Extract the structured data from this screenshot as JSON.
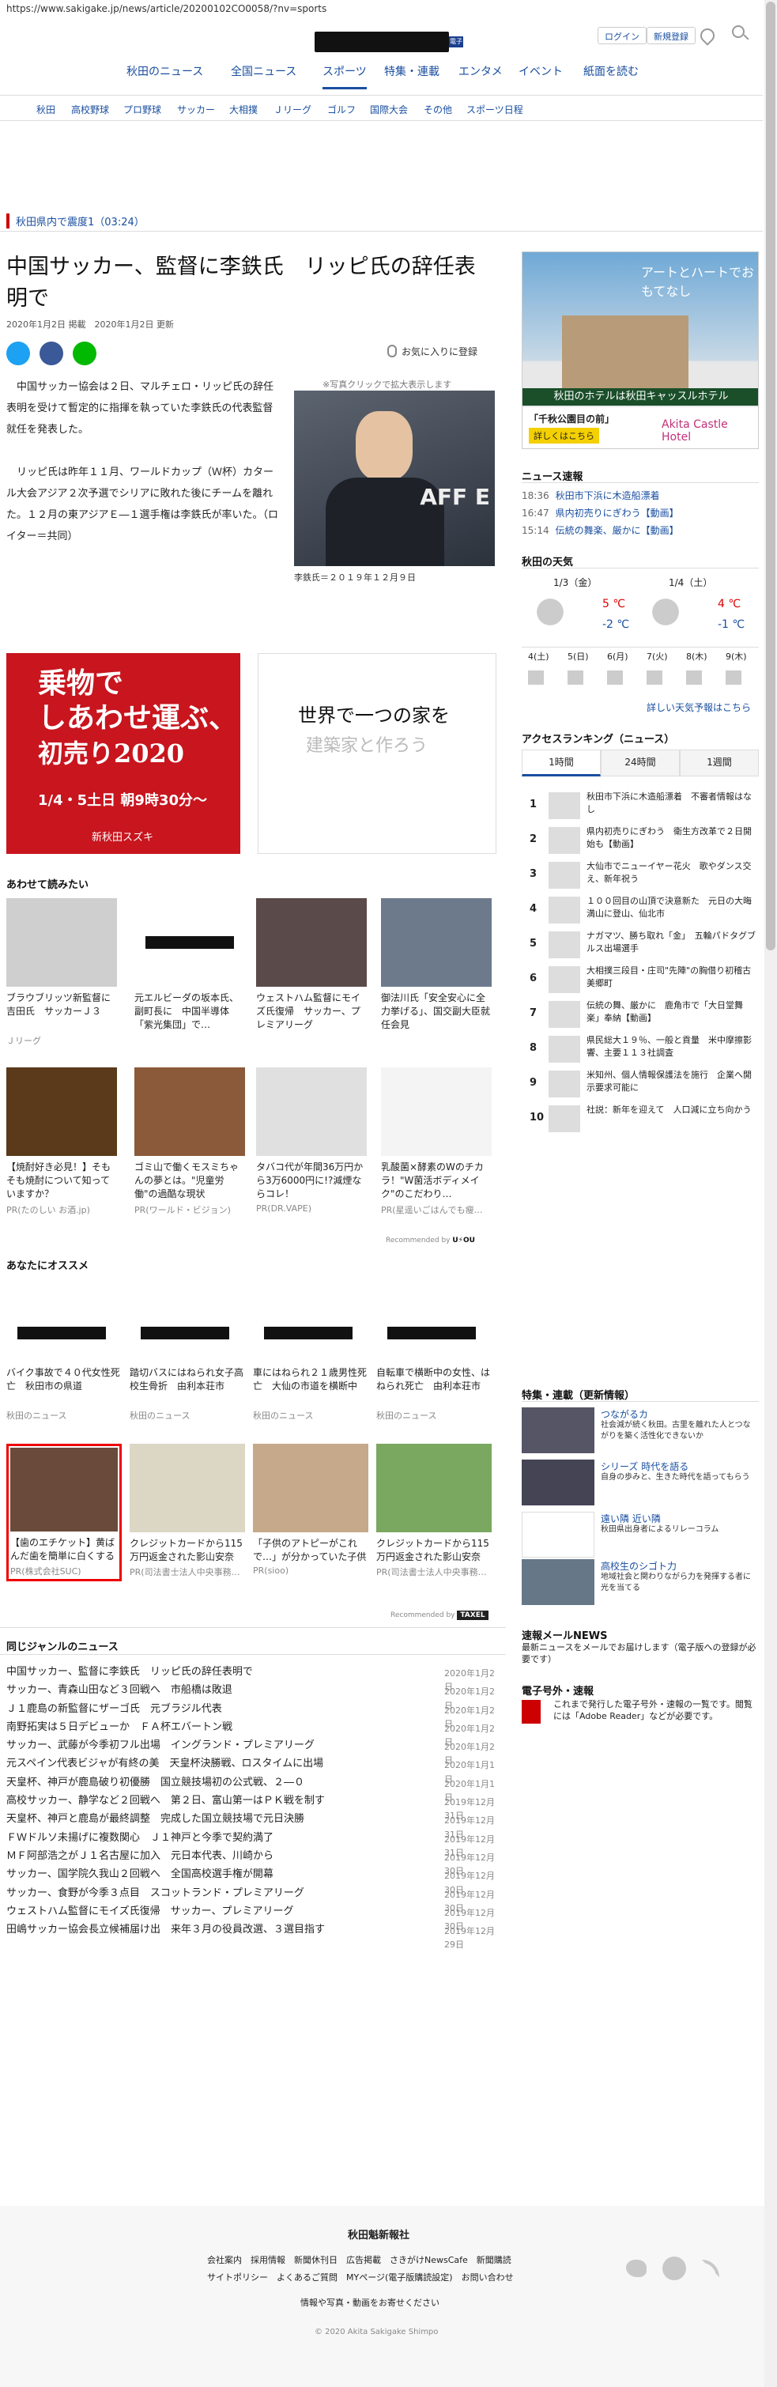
{
  "url": "https://www.sakigake.jp/news/article/20200102CO0058/?nv=sports",
  "header": {
    "login": "ログイン",
    "register": "新規登録"
  },
  "mainnav": [
    "秋田のニュース",
    "全国ニュース",
    "スポーツ",
    "特集・連載",
    "エンタメ",
    "イベント",
    "紙面を読む"
  ],
  "subnav": [
    "秋田",
    "高校野球",
    "プロ野球",
    "サッカー",
    "大相撲",
    "Ｊリーグ",
    "ゴルフ",
    "国際大会",
    "その他",
    "スポーツ日程"
  ],
  "breaking": "秋田県内で震度1（03:24）",
  "article": {
    "title": "中国サッカー、監督に李鉄氏　リッピ氏の辞任表明で",
    "date": "2020年1月2日 掲載　2020年1月2日 更新",
    "fav": "お気に入りに登録",
    "photo_note": "※写真クリックで拡大表示します",
    "photo_caption": "李鉄氏＝２０１９年１２月９日",
    "p1": "中国サッカー協会は２日、マルチェロ・リッピ氏の辞任表明を受けて暫定的に指揮を執っていた李鉄氏の代表監督就任を発表した。",
    "p2": "リッピ氏は昨年１１月、ワールドカップ（Ｗ杯）カタール大会アジア２次予選でシリアに敗れた後にチームを離れた。１２月の東アジアＥ―１選手権は李鉄氏が率いた。（ロイター＝共同）"
  },
  "ads": {
    "ad1_l1": "乗物で",
    "ad1_l2": "しあわせ運ぶ、",
    "ad1_l3": "初売り2020",
    "ad1_date": "1/4・5土日 朝9時30分～",
    "ad1_brand": "新秋田スズキ",
    "ad2_l1": "世界で一つの家を",
    "ad2_l2": "建築家と作ろう"
  },
  "related": {
    "heading": "あわせて読みたい",
    "items": [
      {
        "t": "ブラウブリッツ新監督に吉田氏　サッカーＪ３",
        "s": "Ｊリーグ"
      },
      {
        "t": "元エルビーダの坂本氏、副町長に　中国半導体「紫光集団」で…",
        "s": ""
      },
      {
        "t": "ウェストハム監督にモイズ氏復帰　サッカー、プレミアリーグ",
        "s": ""
      },
      {
        "t": "御法川氏「安全安心に全力挙げる」、国交副大臣就任会見",
        "s": ""
      },
      {
        "t": "【焼酎好き必見！】そもそも焼酎について知っていますか？",
        "s": "PR(たのしい お酒.jp)"
      },
      {
        "t": "ゴミ山で働くモスミちゃんの夢とは。\"児童労働\"の過酷な現状",
        "s": "PR(ワールド・ビジョン)"
      },
      {
        "t": "タバコ代が年間36万円から3万6000円に!?減煙ならコレ！",
        "s": "PR(DR.VAPE)"
      },
      {
        "t": "乳酸菌×酵素のWのチカラ！\"W菌活ボディメイク\"のこだわり…",
        "s": "PR(星遥いごはんでも瘦…"
      }
    ],
    "recommended": "Recommended by"
  },
  "recommend": {
    "heading": "あなたにオススメ",
    "items": [
      {
        "t": "バイク事故で４０代女性死亡　秋田市の県道",
        "s": "秋田のニュース"
      },
      {
        "t": "踏切バスにはねられ女子高校生骨折　由利本荘市",
        "s": "秋田のニュース"
      },
      {
        "t": "車にはねられ２１歳男性死亡　大仙の市道を横断中",
        "s": "秋田のニュース"
      },
      {
        "t": "自転車で横断中の女性、はねられ死亡　由利本荘市",
        "s": "秋田のニュース"
      },
      {
        "t": "【歯のエチケット】黄ばんだ歯を簡単に白くする方法が大…",
        "s": "PR(株式会社SUC)"
      },
      {
        "t": "クレジットカードから115万円返金された影山安奈（68）男性",
        "s": "PR(司法書士法人中央事務…"
      },
      {
        "t": "「子供のアトピーがこれで…」が分かっていた子供の石鹸を変え…",
        "s": "PR(sioo)"
      },
      {
        "t": "クレジットカードから115万円返金された影山安奈（68）男性",
        "s": "PR(司法書士法人中央事務…"
      }
    ],
    "recommended": "Recommended by"
  },
  "same_genre": {
    "heading": "同じジャンルのニュース",
    "items": [
      {
        "t": "中国サッカー、監督に李鉄氏　リッピ氏の辞任表明で",
        "d": "2020年1月2日"
      },
      {
        "t": "サッカー、青森山田など３回戦へ　市船橋は敗退",
        "d": "2020年1月2日"
      },
      {
        "t": "Ｊ１鹿島の新監督にザーゴ氏　元ブラジル代表",
        "d": "2020年1月2日"
      },
      {
        "t": "南野拓実は５日デビューか　ＦＡ杯エバートン戦",
        "d": "2020年1月2日"
      },
      {
        "t": "サッカー、武藤が今季初フル出場　イングランド・プレミアリーグ",
        "d": "2020年1月2日"
      },
      {
        "t": "元スペイン代表ビジャが有終の美　天皇杯決勝戦、ロスタイムに出場",
        "d": "2020年1月1日"
      },
      {
        "t": "天皇杯、神戸が鹿島破り初優勝　国立競技場初の公式戦、２―０",
        "d": "2020年1月1日"
      },
      {
        "t": "高校サッカー、静学など２回戦へ　第２日、富山第一はＰＫ戦を制す",
        "d": "2019年12月31日"
      },
      {
        "t": "天皇杯、神戸と鹿島が最終調整　完成した国立競技場で元日決勝",
        "d": "2019年12月31日"
      },
      {
        "t": "ＦＷドルソ未揚げに複数関心　Ｊ１神戸と今季で契約満了",
        "d": "2019年12月31日"
      },
      {
        "t": "ＭＦ阿部浩之がＪ１名古屋に加入　元日本代表、川崎から",
        "d": "2019年12月30日"
      },
      {
        "t": "サッカー、国学院久我山２回戦へ　全国高校選手権が開幕",
        "d": "2019年12月30日"
      },
      {
        "t": "サッカー、食野が今季３点目　スコットランド・プレミアリーグ",
        "d": "2019年12月30日"
      },
      {
        "t": "ウェストハム監督にモイズ氏復帰　サッカー、プレミアリーグ",
        "d": "2019年12月30日"
      },
      {
        "t": "田嶋サッカー協会長立候補届け出　来年３月の役員改選、３選目指す",
        "d": "2019年12月29日"
      }
    ]
  },
  "sidebar": {
    "ad_head": "アートとハートでおもてなし",
    "ad_bar": "秋田のホテルは秋田キャッスルホテル",
    "ad_sub1": "「千秋公園目の前」",
    "ad_sub2": "詳しくはこちら",
    "ad_brand": "Akita Castle Hotel",
    "news_heading": "ニュース速報",
    "news": [
      {
        "time": "18:36",
        "t": "秋田市下浜に木造船漂着"
      },
      {
        "time": "16:47",
        "t": "県内初売りにぎわう【動画】"
      },
      {
        "time": "15:14",
        "t": "伝統の舞楽、厳かに【動画】"
      }
    ],
    "weather_heading": "秋田の天気",
    "weather_days": [
      "1/3（金）",
      "1/4（土）"
    ],
    "weather_temps": [
      "5 ℃",
      "-2 ℃",
      "4 ℃",
      "-1 ℃"
    ],
    "weather_week": [
      "4(土)",
      "5(日)",
      "6(月)",
      "7(火)",
      "8(木)",
      "9(木)"
    ],
    "weather_link": "詳しい天気予報はこちら",
    "ranking_heading": "アクセスランキング（ニュース）",
    "ranking_tabs": [
      "1時間",
      "24時間",
      "1週間"
    ],
    "ranking": [
      "秋田市下浜に木造船漂着　不審者情報はなし",
      "県内初売りにぎわう　衛生方改革で２日開始も【動画】",
      "大仙市でニューイヤー花火　歌やダンス交え、新年祝う",
      "１００回目の山頂で決意新た　元日の大晦満山に登山、仙北市",
      "ナガマツ、勝ち取れ「金」　五輪パドタグブルス出場選手",
      "大相撲三段目・庄司\"先陣\"の胸借り初稽古　美郷町",
      "伝統の舞、厳かに　鹿角市で「大日堂舞楽」奉納【動画】",
      "県民総大１９％、一般と貢量　米中摩擦影響、主要１１３社調査",
      "米知州、個人情報保護法を施行　企業へ開示要求可能に",
      "社説：新年を迎えて　人口減に立ち向かう"
    ],
    "feature_heading": "特集・連載（更新情報）",
    "features": [
      {
        "t": "つながるカ",
        "d": "社会減が続く秋田。古里を離れた人とつながりを築く活性化できないか"
      },
      {
        "t": "シリーズ 時代を語る",
        "d": "自身の歩みと、生きた時代を語ってもらう"
      },
      {
        "t": "遠い隣 近い隣",
        "d": "秋田県出身者によるリレーコラム"
      },
      {
        "t": "高校生のシゴト力",
        "d": "地域社会と関わりながら力を発揮する者に光を当てる"
      }
    ],
    "mail_heading": "速報メールNEWS",
    "mail_text": "最新ニュースをメールでお届けします（電子版への登録が必要です）",
    "extra_heading": "電子号外・速報",
    "extra_text": "これまで発行した電子号外・速報の一覧です。閲覧には「Adobe Reader」などが必要です。"
  },
  "footer": {
    "company": "秋田魁新報社",
    "links1": [
      "会社案内",
      "採用情報",
      "新聞休刊日",
      "広告掲載",
      "さきがけNewsCafe",
      "新聞購読"
    ],
    "links2": [
      "サイトポリシー",
      "よくあるご質問",
      "MYページ(電子版購読設定)",
      "お問い合わせ"
    ],
    "note": "情報や写真・動画をお寄せください",
    "copyright": "© 2020 Akita Sakigake Shimpo"
  },
  "colors": {
    "accent": "#1a4fa0",
    "red": "#c00"
  }
}
